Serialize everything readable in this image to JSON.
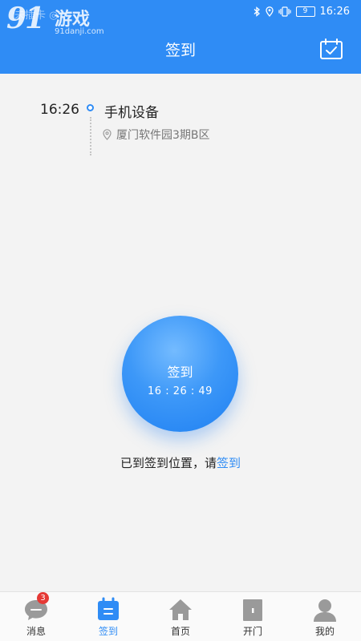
{
  "status_bar": {
    "carrier": "未插卡 ◎",
    "battery": "9",
    "time": "16:26"
  },
  "watermark": {
    "number": "91",
    "brand": "游戏",
    "domain": "91danji.com"
  },
  "header": {
    "title": "签到"
  },
  "record": {
    "time": "16:26",
    "device": "手机设备",
    "location": "厦门软件园3期B区"
  },
  "checkin": {
    "label": "签到",
    "clock": "16 : 26 : 49"
  },
  "hint": {
    "text": "已到签到位置，请",
    "link": "签到"
  },
  "tabs": [
    {
      "label": "消息",
      "icon": "message-icon",
      "badge": "3"
    },
    {
      "label": "签到",
      "icon": "checkin-icon",
      "active": true
    },
    {
      "label": "首页",
      "icon": "home-icon"
    },
    {
      "label": "开门",
      "icon": "door-icon"
    },
    {
      "label": "我的",
      "icon": "user-icon"
    }
  ],
  "colors": {
    "accent": "#2f8cf5",
    "background": "#f3f3f3",
    "badge": "#e53935",
    "tab_inactive": "#9a9a9a"
  }
}
